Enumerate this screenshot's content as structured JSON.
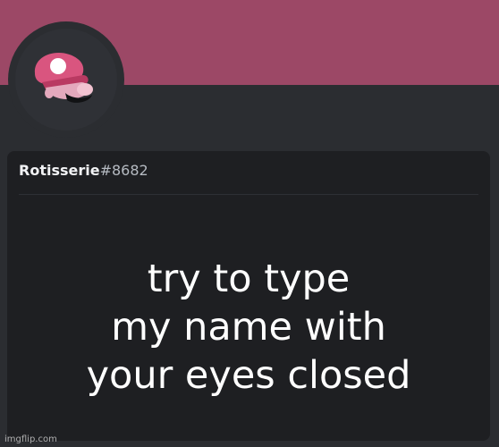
{
  "profile": {
    "username": "Rotisserie",
    "discriminator": "#8682",
    "avatar_icon": "mario-cap-icon"
  },
  "message": {
    "line1": "try to type",
    "line2": "my name with",
    "line3": "your eyes closed"
  },
  "watermark": "imgflip.com",
  "colors": {
    "banner": "#9c4866",
    "background": "#2b2d31",
    "card": "#1e1f22",
    "accent_pink": "#d9557f"
  }
}
